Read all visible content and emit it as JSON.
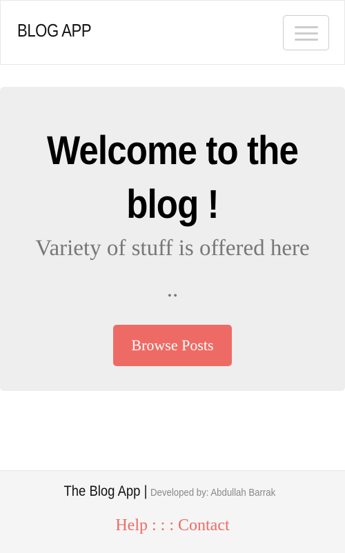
{
  "navbar": {
    "brand": "BLOG APP",
    "toggle_icon": "hamburger-menu-icon"
  },
  "hero": {
    "headline_line1": "Welcome to the",
    "headline_line2": "blog !",
    "subtitle": "Variety of stuff is offered here ..",
    "button_label": "Browse Posts"
  },
  "footer": {
    "app_name": "The Blog App |",
    "developer": "Developed by: Abdullah Barrak",
    "help_label": "Help",
    "separator": ": : :",
    "contact_label": "Contact"
  },
  "colors": {
    "accent": "#ee6b65",
    "hero_bg": "#eeeeee",
    "footer_bg": "#f5f5f5"
  }
}
